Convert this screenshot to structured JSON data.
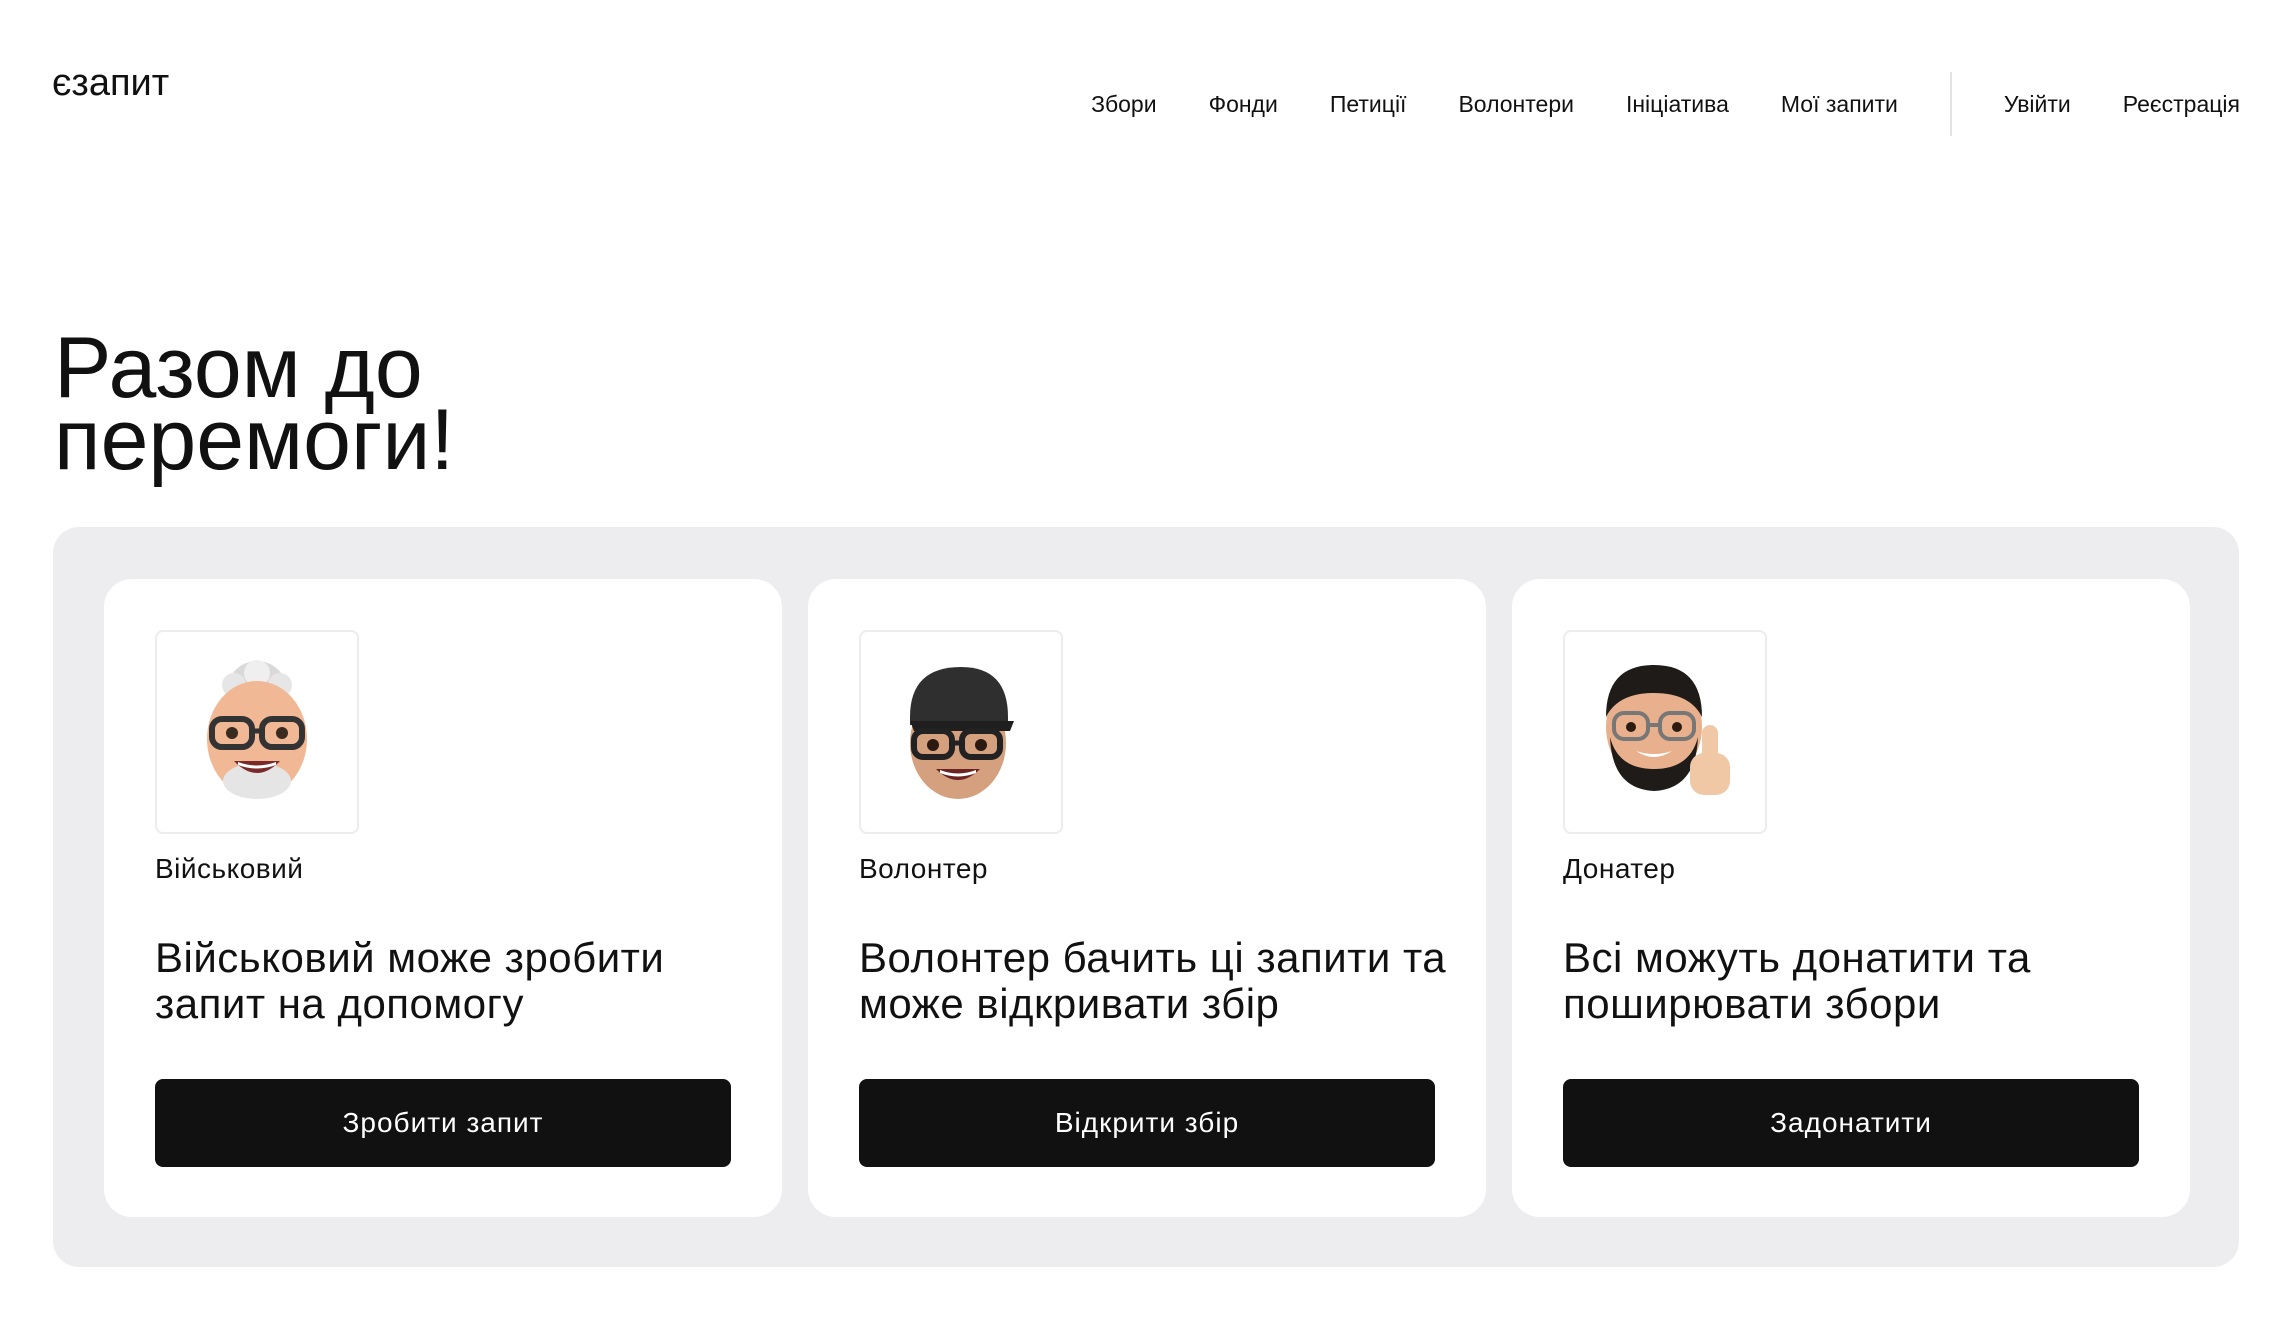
{
  "header": {
    "logo": "єзапит",
    "nav": [
      "Збори",
      "Фонди",
      "Петиції",
      "Волонтери",
      "Ініціатива",
      "Мої запити"
    ],
    "login": "Увійти",
    "register": "Реєстрація"
  },
  "hero": {
    "line1": "Разом до",
    "line2": "перемоги!"
  },
  "cards": [
    {
      "role": "Військовий",
      "description": "Військовий може зробити запит на допомогу",
      "button": "Зробити запит",
      "avatar": "memoji-gray-hair-glasses"
    },
    {
      "role": "Волонтер",
      "description": "Волонтер бачить ці запити та може відкривати збір",
      "button": "Відкрити збір",
      "avatar": "memoji-black-cap-glasses"
    },
    {
      "role": "Донатер",
      "description": "Всі можуть донатити та поширювати збори",
      "button": "Задонатити",
      "avatar": "memoji-beard-thumbs-up"
    }
  ],
  "colors": {
    "panel": "#ededf0",
    "button": "#111111",
    "text": "#111111"
  }
}
